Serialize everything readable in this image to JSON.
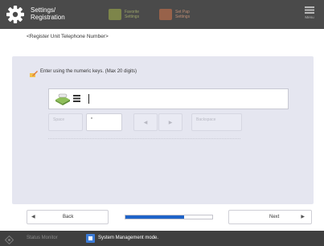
{
  "header": {
    "title_line1": "Settings/",
    "title_line2": "Registration",
    "favorite_label_1": "Favorite",
    "favorite_label_2": "Settings",
    "paper_label_1": "Set Pap",
    "paper_label_2": "Settings",
    "menu_label": "Menu"
  },
  "page_title": "<Register Unit Telephone Number>",
  "instruction": "Enter using the numeric keys. (Max 20 digits)",
  "input": {
    "value": ""
  },
  "keys": {
    "space": "Space",
    "star": "*",
    "left": "◀",
    "right": "▶",
    "backspace": "Backspace"
  },
  "nav": {
    "back_arrow": "◀",
    "back": "Back",
    "next": "Next",
    "next_arrow": "▶"
  },
  "progress": {
    "fraction": 0.68
  },
  "status": {
    "monitor": "Status Monitor",
    "mode": "System Management mode."
  },
  "colors": {
    "accent": "#1e63c8",
    "topbar": "#4a4a4a",
    "panel": "#e5e6f0"
  }
}
